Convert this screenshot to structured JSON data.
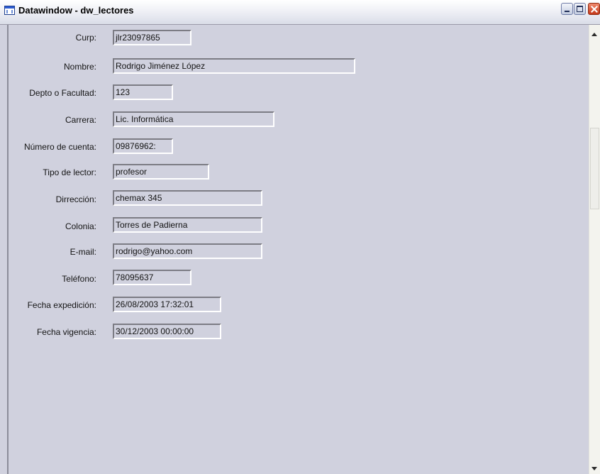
{
  "window": {
    "title": "Datawindow - dw_lectores"
  },
  "form": {
    "fields": [
      {
        "label": "Curp:",
        "value": "jlr23097865"
      },
      {
        "label": "Nombre:",
        "value": "Rodrigo Jiménez López"
      },
      {
        "label": "Depto o Facultad:",
        "value": "123"
      },
      {
        "label": "Carrera:",
        "value": "Lic. Informática"
      },
      {
        "label": "Número de cuenta:",
        "value": "09876962:"
      },
      {
        "label": "Tipo de lector:",
        "value": "profesor"
      },
      {
        "label": "Dirrección:",
        "value": "chemax 345"
      },
      {
        "label": "Colonia:",
        "value": "Torres de Padierna"
      },
      {
        "label": "E-mail:",
        "value": "rodrigo@yahoo.com"
      },
      {
        "label": "Teléfono:",
        "value": "78095637"
      },
      {
        "label": "Fecha expedición:",
        "value": "26/08/2003 17:32:01"
      },
      {
        "label": "Fecha vigencia:",
        "value": "30/12/2003 00:00:00"
      }
    ]
  },
  "colors": {
    "background": "#d0d1de",
    "titlebar": "#e6e8f0",
    "close_button": "#d9492a"
  },
  "icons": {
    "window_icon": "datawindow-icon",
    "minimize": "minimize-icon",
    "maximize": "maximize-icon",
    "close": "close-icon",
    "scroll_up": "arrow-up-icon",
    "scroll_down": "arrow-down-icon"
  }
}
